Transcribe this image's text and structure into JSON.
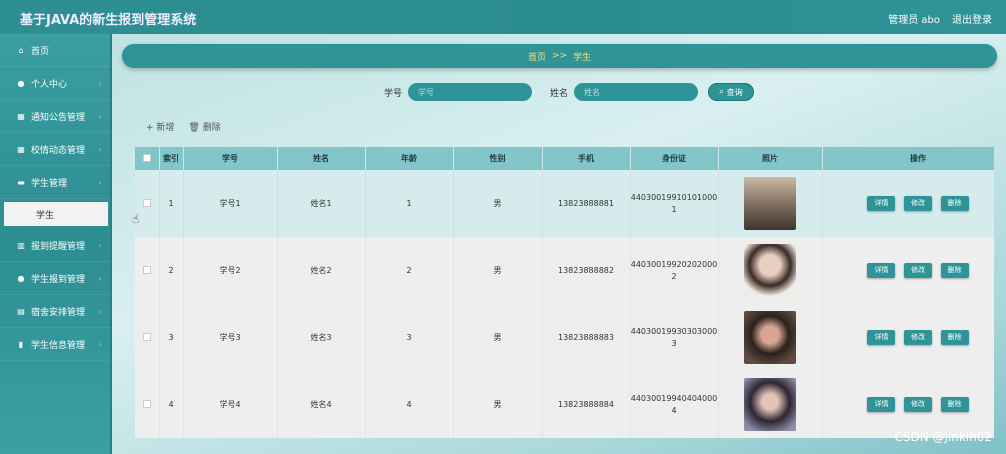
{
  "header": {
    "app_title": "基于JAVA的新生报到管理系统",
    "admin_label": "管理员 abo",
    "logout_label": "退出登录"
  },
  "sidebar": {
    "items": [
      {
        "icon": "home-icon",
        "label": "首页"
      },
      {
        "icon": "person-icon",
        "label": "个人中心"
      },
      {
        "icon": "grid-icon",
        "label": "通知公告管理"
      },
      {
        "icon": "grid-icon",
        "label": "校情动态管理"
      },
      {
        "icon": "monitor-icon",
        "label": "学生管理"
      },
      {
        "icon": "building-icon",
        "label": "报到提醒管理"
      },
      {
        "icon": "person-icon",
        "label": "学生报到管理"
      },
      {
        "icon": "bed-icon",
        "label": "宿舍安排管理"
      },
      {
        "icon": "bar-chart-icon",
        "label": "学生信息管理"
      }
    ],
    "sub_item": "学生"
  },
  "breadcrumb": {
    "home": "首页",
    "separator": ">>",
    "current": "学生"
  },
  "search": {
    "student_no_label": "学号",
    "student_no_placeholder": "学号",
    "name_label": "姓名",
    "name_placeholder": "姓名",
    "button_label": "查询"
  },
  "actions": {
    "add_label": "+ 新增",
    "delete_label": "删除"
  },
  "table": {
    "columns": [
      "索引",
      "学号",
      "姓名",
      "年龄",
      "性别",
      "手机",
      "身份证",
      "照片",
      "操作"
    ],
    "rows": [
      {
        "index": "1",
        "student_no": "学号1",
        "name": "姓名1",
        "age": "1",
        "gender": "男",
        "phone": "13823888881",
        "id_card_line1": "44030019910101000",
        "id_card_line2": "1"
      },
      {
        "index": "2",
        "student_no": "学号2",
        "name": "姓名2",
        "age": "2",
        "gender": "男",
        "phone": "13823888882",
        "id_card_line1": "44030019920202000",
        "id_card_line2": "2"
      },
      {
        "index": "3",
        "student_no": "学号3",
        "name": "姓名3",
        "age": "3",
        "gender": "男",
        "phone": "13823888883",
        "id_card_line1": "44030019930303000",
        "id_card_line2": "3"
      },
      {
        "index": "4",
        "student_no": "学号4",
        "name": "姓名4",
        "age": "4",
        "gender": "男",
        "phone": "13823888884",
        "id_card_line1": "44030019940404000",
        "id_card_line2": "4"
      }
    ],
    "row_buttons": {
      "detail": "详情",
      "edit": "修改",
      "delete": "删除"
    }
  },
  "watermark": "CSDN @jinkin02",
  "colors": {
    "primary": "#2f9497",
    "header_bg": "#2e8f93",
    "breadcrumb_text": "#f2e17a"
  }
}
